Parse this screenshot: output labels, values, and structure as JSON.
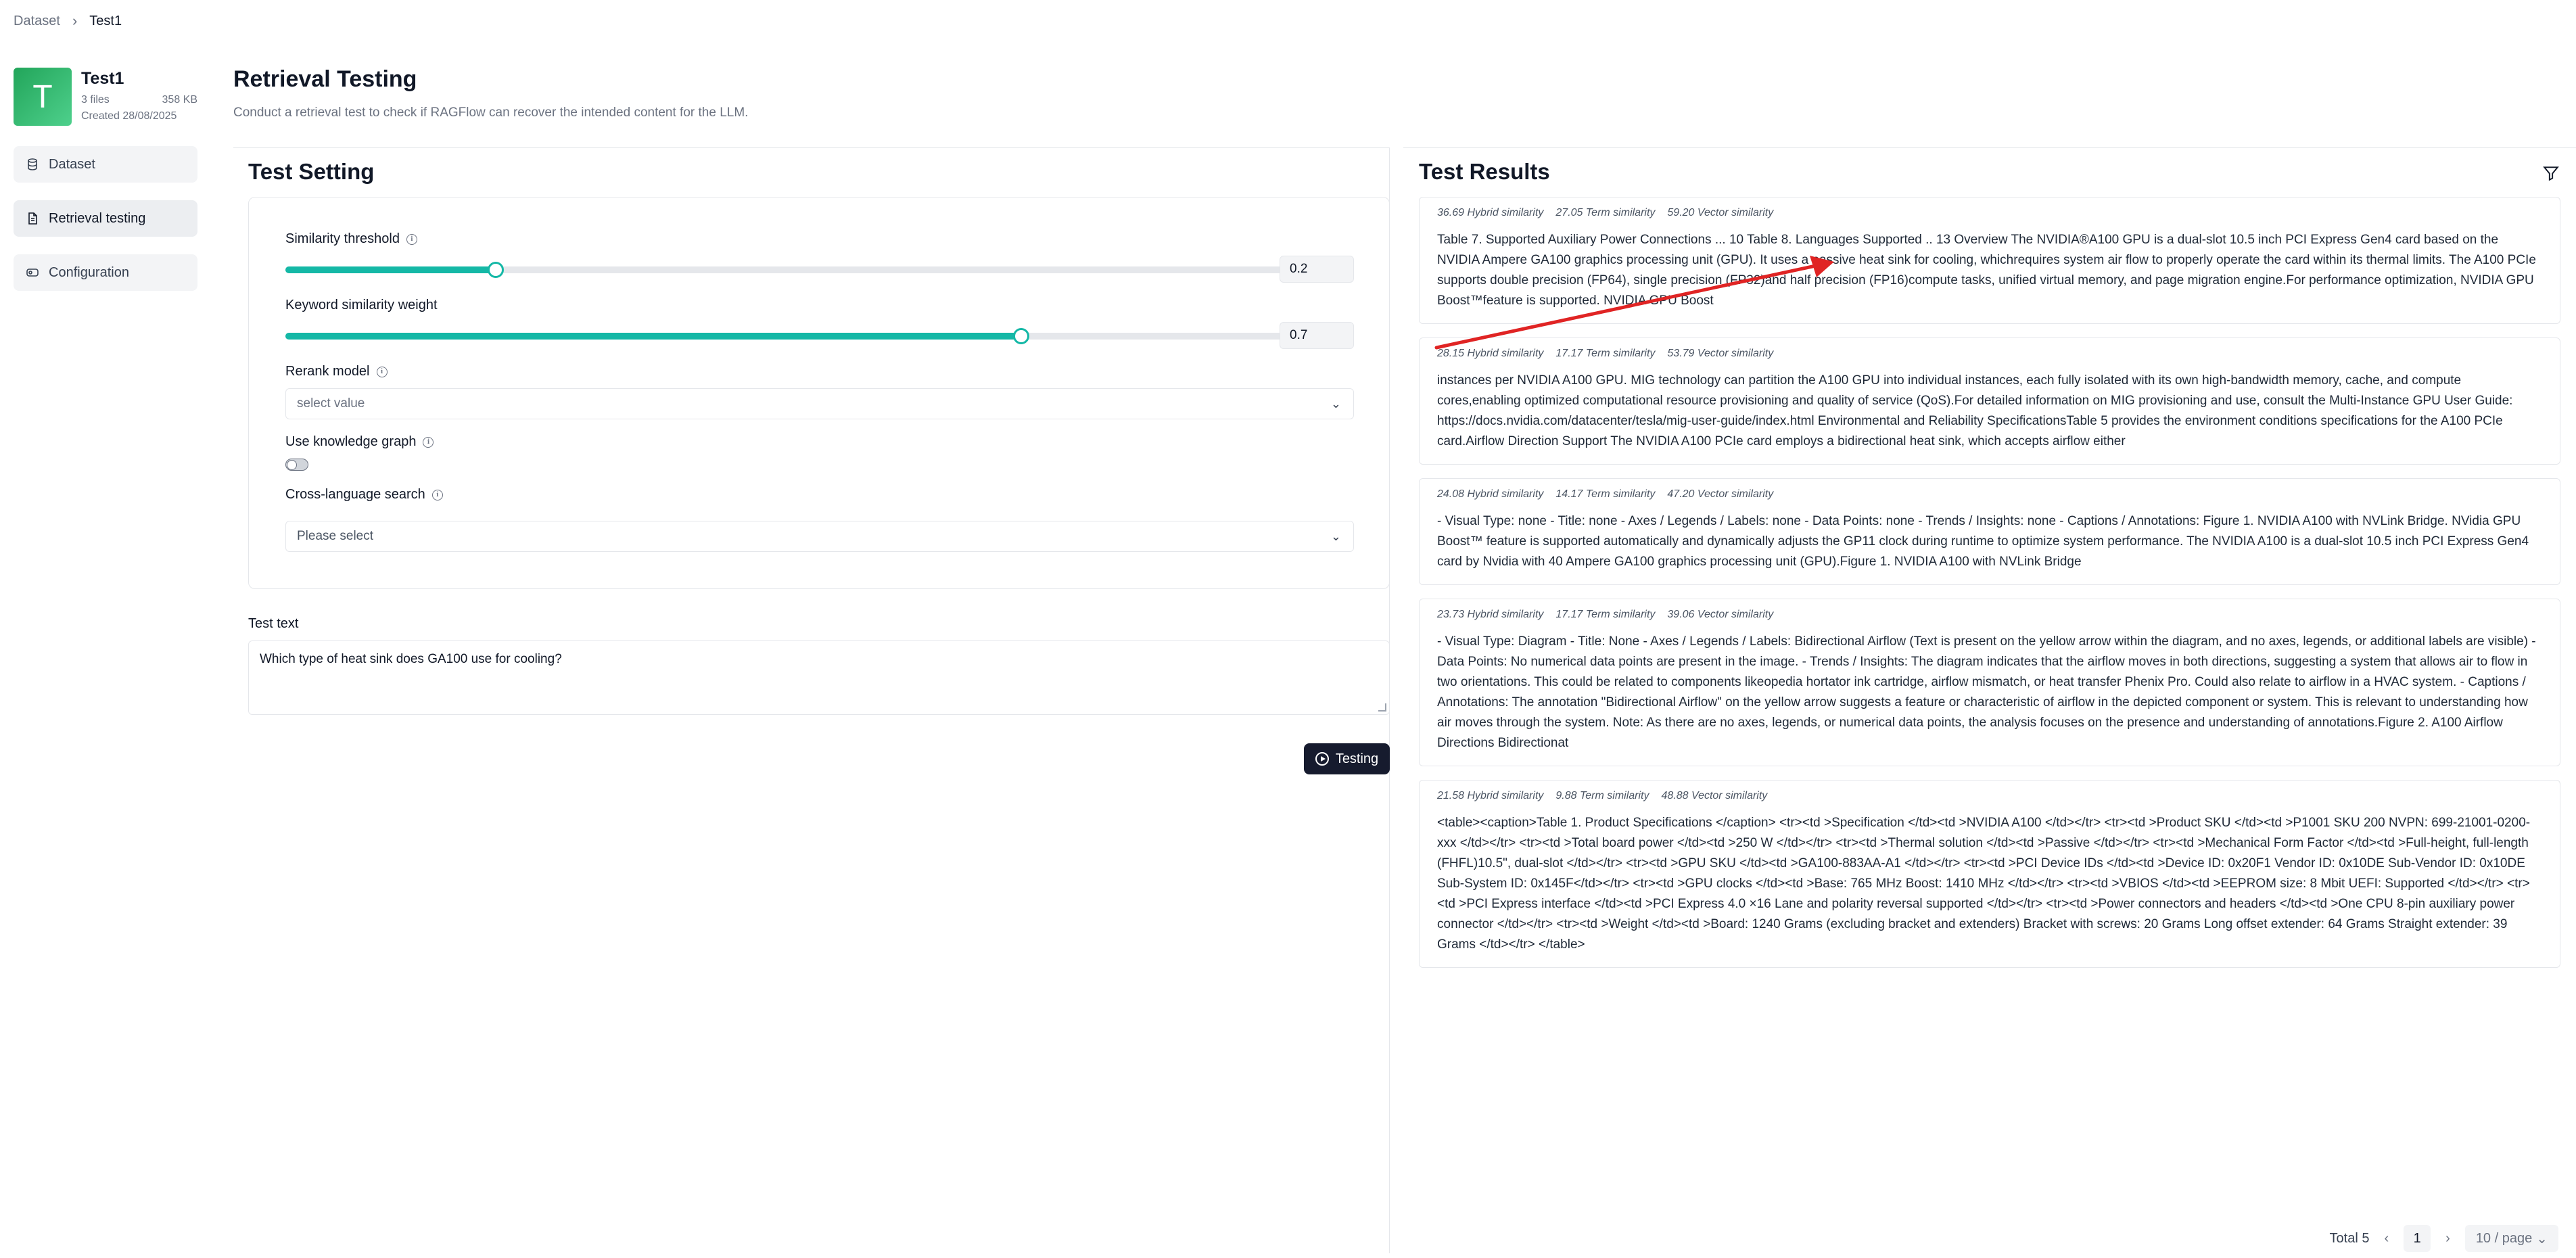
{
  "breadcrumb": {
    "root": "Dataset",
    "separator": "›",
    "current": "Test1"
  },
  "dataset": {
    "avatar_letter": "T",
    "name": "Test1",
    "files": "3 files",
    "size": "358 KB",
    "created": "Created 28/08/2025"
  },
  "nav": {
    "dataset": "Dataset",
    "retrieval": "Retrieval testing",
    "configuration": "Configuration"
  },
  "header": {
    "title": "Retrieval Testing",
    "subtitle": "Conduct a retrieval test to check if RAGFlow can recover the intended content for the LLM."
  },
  "settings": {
    "title": "Test Setting",
    "similarity_threshold": {
      "label": "Similarity threshold",
      "value": "0.2",
      "fraction": 0.2
    },
    "keyword_weight": {
      "label": "Keyword similarity weight",
      "value": "0.7",
      "fraction": 0.7
    },
    "rerank": {
      "label": "Rerank model",
      "placeholder": "select value"
    },
    "knowledge_graph": {
      "label": "Use knowledge graph",
      "enabled": false
    },
    "cross_language": {
      "label": "Cross-language search",
      "placeholder": "Please select"
    }
  },
  "test": {
    "label": "Test text",
    "value": "Which type of heat sink does GA100 use for cooling?",
    "button": "Testing"
  },
  "results": {
    "title": "Test Results",
    "items": [
      {
        "hybrid": "36.69 Hybrid similarity",
        "term": "27.05 Term similarity",
        "vector": "59.20 Vector similarity",
        "text": "Table 7. Supported Auxiliary Power Connections ... 10 Table 8. Languages Supported .. 13 Overview The NVIDIA®A100 GPU is a dual-slot 10.5 inch PCI Express Gen4 card based on the NVIDIA Ampere GA100 graphics processing unit (GPU). It uses a passive heat sink for cooling, whichrequires system air flow to properly operate the card within its thermal limits. The A100 PCIe supports double precision (FP64), single precision (FP32)and half precision (FP16)compute tasks, unified virtual memory, and page migration engine.For performance optimization, NVIDIA GPU Boost™feature is supported. NVIDIA GPU Boost"
      },
      {
        "hybrid": "28.15 Hybrid similarity",
        "term": "17.17 Term similarity",
        "vector": "53.79 Vector similarity",
        "text": "instances per NVIDIA A100 GPU. MIG technology can partition the A100 GPU into individual instances, each fully isolated with its own high-bandwidth memory, cache, and compute cores,enabling optimized computational resource provisioning and quality of service (QoS).For detailed information on MIG provisioning and use, consult the Multi-Instance GPU User Guide: https://docs.nvidia.com/datacenter/tesla/mig-user-guide/index.html Environmental and Reliability SpecificationsTable 5 provides the environment conditions specifications for the A100 PCIe card.Airflow Direction Support The NVIDIA A100 PCIe card employs a bidirectional heat sink, which accepts airflow either"
      },
      {
        "hybrid": "24.08 Hybrid similarity",
        "term": "14.17 Term similarity",
        "vector": "47.20 Vector similarity",
        "text": "- Visual Type: none - Title: none - Axes / Legends / Labels: none - Data Points: none - Trends / Insights: none - Captions / Annotations: Figure 1. NVIDIA A100 with NVLink Bridge. NVidia GPU Boost™ feature is supported automatically and dynamically adjusts the GP11 clock during runtime to optimize system performance. The NVIDIA A100 is a dual-slot 10.5 inch PCI Express Gen4 card by Nvidia with 40 Ampere GA100 graphics processing unit (GPU).Figure 1. NVIDIA A100 with NVLink Bridge"
      },
      {
        "hybrid": "23.73 Hybrid similarity",
        "term": "17.17 Term similarity",
        "vector": "39.06 Vector similarity",
        "text": "- Visual Type: Diagram - Title: None - Axes / Legends / Labels: Bidirectional Airflow (Text is present on the yellow arrow within the diagram, and no axes, legends, or additional labels are visible) - Data Points: No numerical data points are present in the image. - Trends / Insights: The diagram indicates that the airflow moves in both directions, suggesting a system that allows air to flow in two orientations. This could be related to components likeopedia hortator ink cartridge, airflow mismatch, or heat transfer Phenix Pro. Could also relate to airflow in a HVAC system. - Captions / Annotations: The annotation \"Bidirectional Airflow\" on the yellow arrow suggests a feature or characteristic of airflow in the depicted component or system. This is relevant to understanding how air moves through the system. Note: As there are no axes, legends, or numerical data points, the analysis focuses on the presence and understanding of annotations.Figure 2. A100 Airflow Directions Bidirectionat"
      },
      {
        "hybrid": "21.58 Hybrid similarity",
        "term": "9.88 Term similarity",
        "vector": "48.88 Vector similarity",
        "text": "<table><caption>Table 1. Product Specifications </caption> <tr><td >Specification </td><td >NVIDIA A100 </td></tr> <tr><td >Product SKU </td><td >P1001 SKU 200 NVPN: 699-21001-0200-xxx </td></tr> <tr><td >Total board power </td><td >250 W </td></tr> <tr><td >Thermal solution </td><td >Passive </td></tr> <tr><td >Mechanical Form Factor </td><td >Full-height, full-length (FHFL)10.5\", dual-slot </td></tr> <tr><td >GPU SKU </td><td >GA100-883AA-A1 </td></tr> <tr><td >PCI Device IDs </td><td >Device ID: 0x20F1 Vendor ID: 0x10DE Sub-Vendor ID: 0x10DE Sub-System ID: 0x145F</td></tr> <tr><td >GPU clocks </td><td >Base: 765 MHz Boost: 1410 MHz </td></tr> <tr><td >VBIOS </td><td >EEPROM size: 8 Mbit UEFI: Supported </td></tr> <tr><td >PCI Express interface </td><td >PCI Express 4.0 ×16 Lane and polarity reversal supported </td></tr> <tr><td >Power connectors and headers </td><td >One CPU 8-pin auxiliary power connector </td></tr> <tr><td >Weight </td><td >Board: 1240 Grams (excluding bracket and extenders) Bracket with screws: 20 Grams Long offset extender: 64 Grams Straight extender: 39 Grams </td></tr> </table>"
      }
    ]
  },
  "pagination": {
    "total": "Total 5",
    "prev": "‹",
    "page": "1",
    "next": "›",
    "page_size": "10 / page",
    "page_size_chevron": "⌄"
  },
  "icons": {
    "dataset": "database-icon",
    "retrieval": "file-text-icon",
    "configuration": "settings-toggle-icon",
    "filter": "filter-icon",
    "info": "info-icon",
    "testing": "play-circle-icon"
  },
  "colors": {
    "accent": "#14b8a6",
    "avatar": "#22a55a",
    "button": "#161b2e",
    "annotation_arrow": "#e02424"
  }
}
